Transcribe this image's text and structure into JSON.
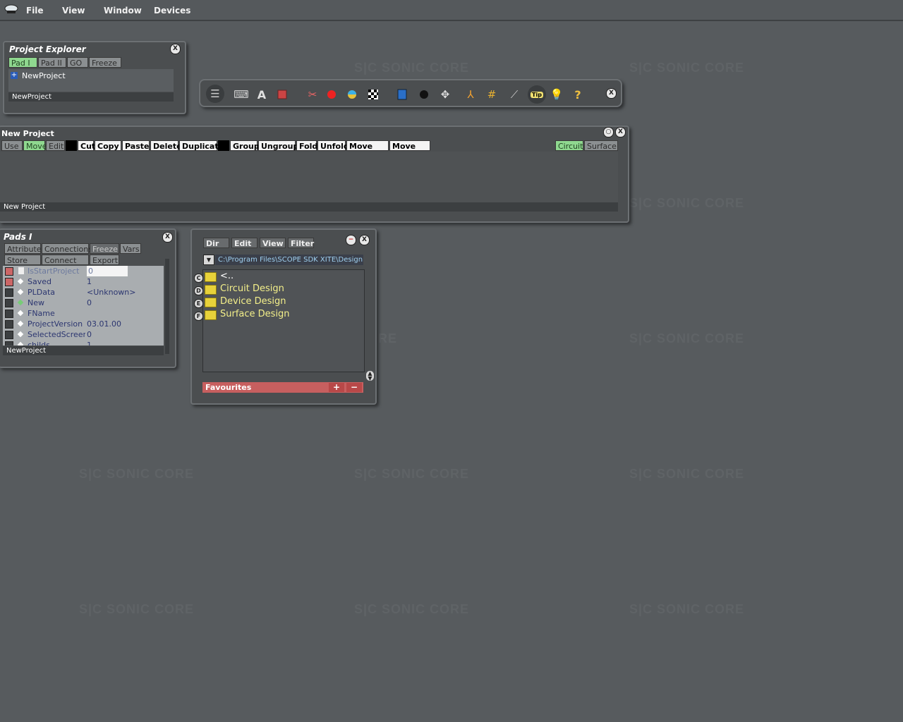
{
  "menu": {
    "file": "File",
    "view": "View",
    "window": "Window",
    "devices": "Devices"
  },
  "watermark": "S|C  SONIC CORE",
  "project_explorer": {
    "title": "Project Explorer",
    "tabs": [
      "Pad I",
      "Pad II",
      "GO",
      "Freeze"
    ],
    "tree_item": "NewProject",
    "status": "NewProject"
  },
  "toolbar": {
    "icons": [
      "list-icon",
      "keyboard-icon",
      "text-icon",
      "chip-icon",
      "wrench-icon",
      "record-icon",
      "color-icon",
      "checker-icon",
      "book-icon",
      "black-dot-icon",
      "move-icon",
      "tripod-icon",
      "grid-icon",
      "wand-icon",
      "tip-icon",
      "bulb-icon",
      "help-icon"
    ],
    "tip_label": "Tip",
    "help_label": "?",
    "text_label": "A"
  },
  "new_project": {
    "title": "New Project",
    "mode_buttons": [
      "Use",
      "Move",
      "Edit"
    ],
    "edit_buttons": [
      "Cut",
      "Copy",
      "Paste",
      "Delete",
      "Duplicate"
    ],
    "group_buttons": [
      "Group",
      "Ungroup",
      "Fold",
      "Unfold",
      "Move into",
      "Move out"
    ],
    "view_buttons": [
      "Circuit",
      "Surface"
    ],
    "status": "New Project"
  },
  "pads": {
    "title": "Pads I",
    "tabs1": [
      "Attributes",
      "Connections",
      "Freeze",
      "Vars"
    ],
    "tabs2": [
      "Store",
      "Connect",
      "Export"
    ],
    "rows": [
      {
        "name": "IsStartProject",
        "value": "0"
      },
      {
        "name": "Saved",
        "value": "1"
      },
      {
        "name": "PLData",
        "value": "<Unknown>"
      },
      {
        "name": "New",
        "value": "0"
      },
      {
        "name": "FName",
        "value": ""
      },
      {
        "name": "ProjectVersion",
        "value": "03.01.00"
      },
      {
        "name": "SelectedScreenS",
        "value": "0"
      },
      {
        "name": "childs",
        "value": "1"
      }
    ],
    "status": "NewProject"
  },
  "browser": {
    "menus": [
      "Dir",
      "Edit",
      "View",
      "Filter"
    ],
    "path": "C:\\Program Files\\SCOPE SDK XITE\\Design",
    "drives": [
      "C",
      "D",
      "E",
      "F"
    ],
    "items": [
      "<..",
      "Circuit Design",
      "Device Design",
      "Surface Design"
    ],
    "favourites": "Favourites",
    "fav_add": "+",
    "fav_remove": "−"
  },
  "close_label": "X"
}
